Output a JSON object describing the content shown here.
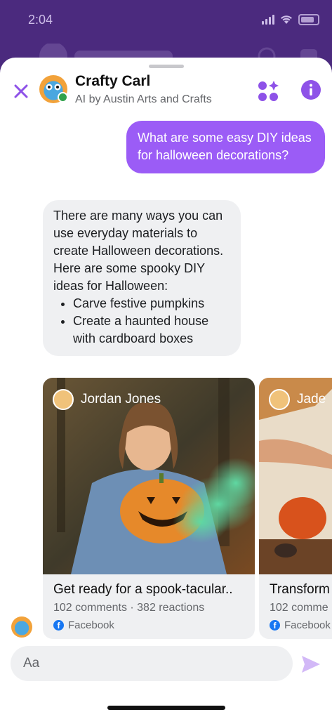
{
  "status_bar": {
    "time": "2:04"
  },
  "header": {
    "title": "Crafty Carl",
    "subtitle": "AI by Austin Arts and Crafts"
  },
  "messages": {
    "outgoing": "What are some easy DIY ideas for halloween decorations?",
    "incoming_text": "There are many ways you can use everyday materials to create Halloween decorations. Here are some spooky DIY ideas for Halloween:",
    "incoming_bullets": [
      "Carve festive pumpkins",
      "Create a haunted house with cardboard boxes"
    ]
  },
  "cards": [
    {
      "author": "Jordan Jones",
      "title": "Get ready for a spook-tacular..",
      "meta": "102 comments · 382 reactions",
      "source": "Facebook"
    },
    {
      "author": "Jade",
      "title": "Transform",
      "meta": "102 comme",
      "source": "Facebook"
    }
  ],
  "composer": {
    "placeholder": "Aa"
  },
  "colors": {
    "accent": "#9b5cf6",
    "header_icons": "#8e52e8",
    "bubble_in": "#eff0f2",
    "facebook": "#1877f2"
  }
}
